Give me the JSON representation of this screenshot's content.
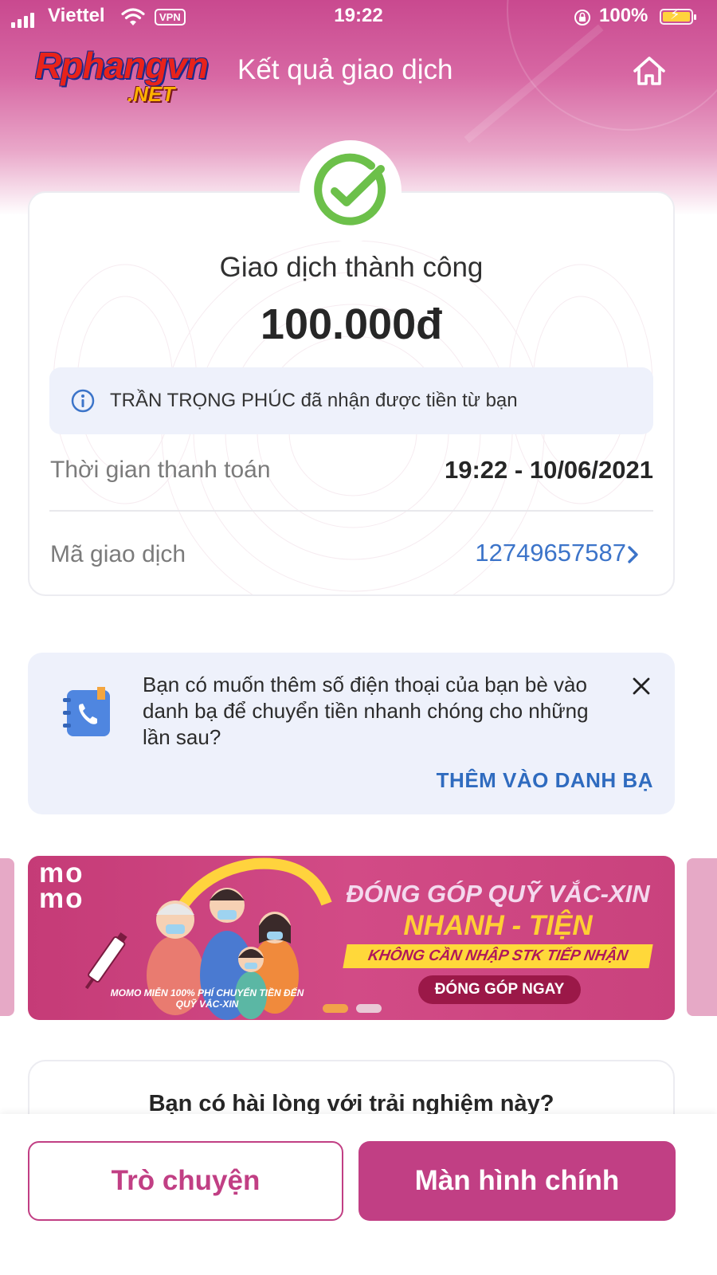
{
  "status_bar": {
    "carrier": "Viettel",
    "vpn": "VPN",
    "time": "19:22",
    "battery": "100%"
  },
  "watermark": {
    "line1": "Rphangvn",
    "line2": ".NET"
  },
  "header": {
    "title": "Kết quả giao dịch",
    "icons": [
      "home-icon"
    ]
  },
  "result": {
    "status": "Giao dịch thành công",
    "amount": "100.000đ",
    "info": "TRẦN TRỌNG PHÚC đã nhận được tiền từ bạn",
    "time_label": "Thời gian thanh toán",
    "time_value": "19:22 - 10/06/2021",
    "txn_label": "Mã giao dịch",
    "txn_value": "12749657587"
  },
  "suggestion": {
    "text": "Bạn có muốn thêm số điện thoại của bạn bè vào danh bạ để chuyển tiền nhanh chóng cho những lần sau?",
    "action": "THÊM VÀO DANH BẠ"
  },
  "banner": {
    "brand_line1": "mo",
    "brand_line2": "mo",
    "headline1": "ĐÓNG GÓP QUỸ VẮC-XIN",
    "headline2": "NHANH - TIỆN",
    "strip": "KHÔNG CẦN NHẬP STK TIẾP NHẬN",
    "cta": "ĐÓNG GÓP NGAY",
    "note": "MOMO MIỄN 100% PHÍ CHUYỂN TIỀN ĐẾN QUỸ VẮC-XIN",
    "slides": 2,
    "active_slide": 1
  },
  "feedback": {
    "title": "Bạn có hài lòng với trải nghiệm này?"
  },
  "actions": {
    "chat": "Trò chuyện",
    "home": "Màn hình chính"
  },
  "colors": {
    "brand": "#c13f84",
    "success": "#6cc04a",
    "link": "#3c74c9",
    "info_bg": "#eef1fb"
  }
}
